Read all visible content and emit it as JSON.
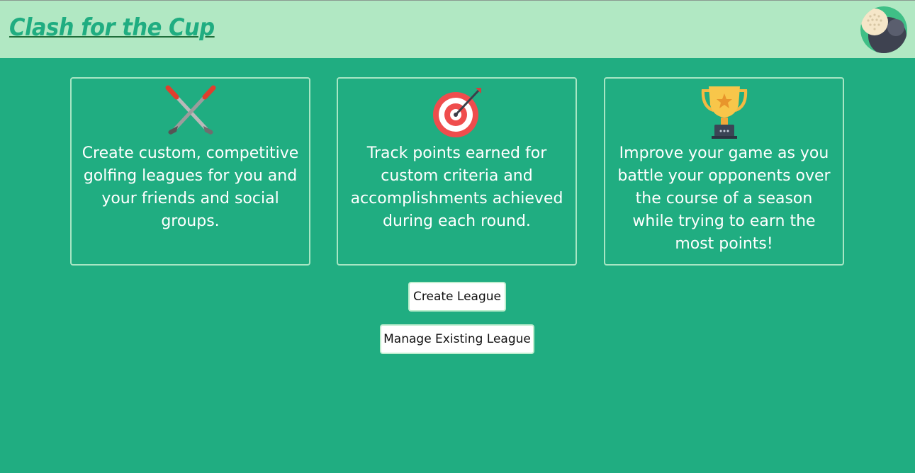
{
  "header": {
    "title": "Clash for the Cup",
    "logo_icon": "golf-ball-icon"
  },
  "features": [
    {
      "icon": "golf-clubs-icon",
      "text": "Create custom, competitive golfing leagues for you and your friends and social groups."
    },
    {
      "icon": "target-icon",
      "text": "Track points earned for custom criteria and accomplishments achieved during each round."
    },
    {
      "icon": "trophy-icon",
      "text": "Improve your game as you battle your opponents over the course of a season while trying to earn the most points!"
    }
  ],
  "actions": {
    "create_label": "Create League",
    "manage_label": "Manage Existing League"
  },
  "colors": {
    "page_bg": "#20ad81",
    "header_bg": "#b1e8c3",
    "card_border": "#a8e6c4"
  }
}
